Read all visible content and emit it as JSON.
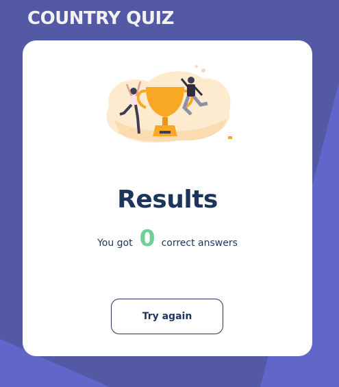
{
  "app": {
    "title": "COUNTRY QUIZ"
  },
  "results": {
    "heading": "Results",
    "prefix": "You got",
    "score": "0",
    "suffix": "correct answers",
    "illustration": "winners-trophy-illustration"
  },
  "actions": {
    "try_again_label": "Try again"
  },
  "colors": {
    "background": "#5459a6",
    "background_accent": "#6166cb",
    "card": "#ffffff",
    "heading": "#1d355d",
    "score": "#6fcf97",
    "trophy": "#f9a826"
  }
}
